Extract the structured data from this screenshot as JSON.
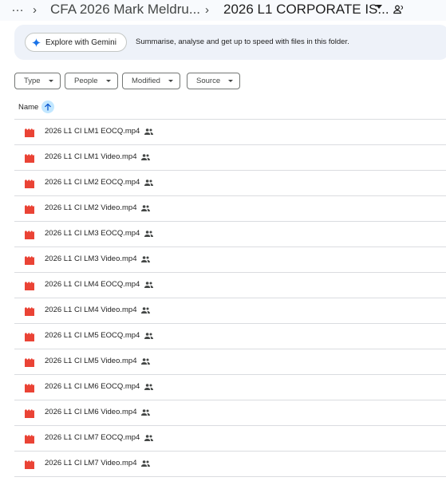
{
  "breadcrumb": {
    "more": "…",
    "items": [
      {
        "label": "CFA 2026 Mark Meldru..."
      },
      {
        "label": "2026 L1 CORPORATE IS..."
      }
    ]
  },
  "gemini": {
    "button_label": "Explore with Gemini",
    "description": "Summarise, analyse and get up to speed with files in this folder."
  },
  "filters": [
    {
      "label": "Type"
    },
    {
      "label": "People"
    },
    {
      "label": "Modified"
    },
    {
      "label": "Source"
    }
  ],
  "list_header": {
    "name_label": "Name",
    "sort": "ascending"
  },
  "files": [
    {
      "name": "2026 L1 CI LM1 EOCQ.mp4"
    },
    {
      "name": "2026 L1 CI LM1 Video.mp4"
    },
    {
      "name": "2026 L1 CI LM2 EOCQ.mp4"
    },
    {
      "name": "2026 L1 CI LM2 Video.mp4"
    },
    {
      "name": "2026 L1 CI LM3 EOCQ.mp4"
    },
    {
      "name": "2026 L1 CI LM3 Video.mp4"
    },
    {
      "name": "2026 L1 CI LM4 EOCQ.mp4"
    },
    {
      "name": "2026 L1 CI LM4 Video.mp4"
    },
    {
      "name": "2026 L1 CI LM5 EOCQ.mp4"
    },
    {
      "name": "2026 L1 CI LM5 Video.mp4"
    },
    {
      "name": "2026 L1 CI LM6 EOCQ.mp4"
    },
    {
      "name": "2026 L1 CI LM6 Video.mp4"
    },
    {
      "name": "2026 L1 CI LM7 EOCQ.mp4"
    },
    {
      "name": "2026 L1 CI LM7 Video.mp4"
    }
  ],
  "icons": {
    "file": "video-file-icon",
    "shared": "shared-people-icon",
    "sort": "arrow-up-icon",
    "gemini": "gemini-sparkle-icon"
  },
  "colors": {
    "video_icon": "#ea4335",
    "sort_bg": "#c2e7ff",
    "gemini_bar": "#eef2f9",
    "gemini_sparkle": "#1a73e8"
  }
}
